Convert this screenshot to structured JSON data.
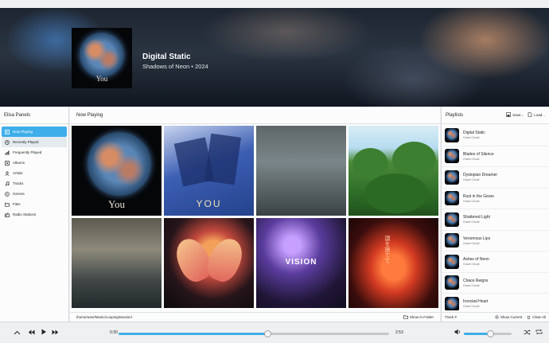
{
  "header": {
    "title": "Digital Static",
    "subtitle": "Shadows of Neon • 2024",
    "cover_text": "You"
  },
  "left_panel": {
    "title": "Elisa Panels",
    "items": [
      {
        "label": "Now Playing",
        "icon": "now-playing-icon",
        "active": true
      },
      {
        "label": "Recently Played",
        "icon": "recently-played-icon"
      },
      {
        "label": "Frequently Played",
        "icon": "frequently-played-icon"
      },
      {
        "label": "Albums",
        "icon": "albums-icon"
      },
      {
        "label": "Artists",
        "icon": "artists-icon"
      },
      {
        "label": "Tracks",
        "icon": "tracks-icon"
      },
      {
        "label": "Genres",
        "icon": "genres-icon"
      },
      {
        "label": "Files",
        "icon": "files-icon"
      },
      {
        "label": "Radio Stations",
        "icon": "radio-icon"
      }
    ]
  },
  "now_playing": {
    "title": "Now Playing",
    "tile_texts": {
      "you": "You",
      "you2": "YOU",
      "vision": "VISION",
      "kanji": "頭を捨てて"
    },
    "path": "/home/user/Music/LoopingSession/",
    "show_in_folder": "Show In Folder"
  },
  "playlists": {
    "title": "Playlists",
    "save_label": "Save...",
    "load_label": "Load...",
    "items": [
      {
        "name": "Digital Static",
        "artist": "Grave Circuit"
      },
      {
        "name": "Blades of Silence",
        "artist": "Grave Circuit"
      },
      {
        "name": "Dystopian Dreamer",
        "artist": "Grave Circuit"
      },
      {
        "name": "Rust in the Gears",
        "artist": "Grave Circuit"
      },
      {
        "name": "Shattered Light",
        "artist": "Grave Circuit"
      },
      {
        "name": "Venomous Lips",
        "artist": "Grave Circuit"
      },
      {
        "name": "Ashes of Neon",
        "artist": "Grave Circuit"
      },
      {
        "name": "Chaos Reigns",
        "artist": "Grave Circuit"
      },
      {
        "name": "Ironclad Heart",
        "artist": "Grave Circuit"
      }
    ],
    "track_label": "Track #",
    "show_current_label": "Show Current",
    "clear_all_label": "Clear All"
  },
  "player": {
    "elapsed": "0:30",
    "total": "2:53",
    "progress": 0.55,
    "volume": 0.55,
    "accent": "#3daee9"
  }
}
